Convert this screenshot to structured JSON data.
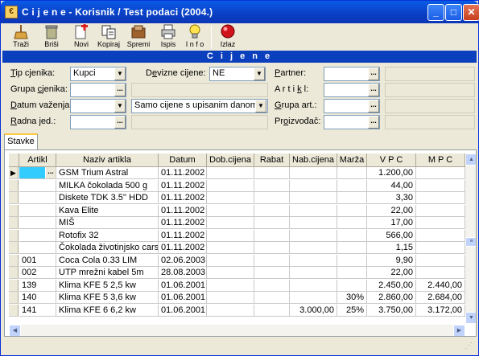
{
  "window": {
    "title": "C i j e n e - Korisnik / Test podaci (2004.)"
  },
  "toolbar": [
    {
      "label": "Traži",
      "icon": "search-broom-icon"
    },
    {
      "label": "Briši",
      "icon": "trash-icon"
    },
    {
      "label": "Novi",
      "icon": "new-document-icon"
    },
    {
      "label": "Kopiraj",
      "icon": "copy-icon"
    },
    {
      "label": "Spremi",
      "icon": "save-books-icon"
    },
    {
      "label": "Ispis",
      "icon": "printer-icon"
    },
    {
      "label": "I n f o",
      "icon": "info-lightbulb-icon"
    },
    {
      "label": "Izlaz",
      "icon": "exit-red-ball-icon"
    }
  ],
  "section_title": "C i j e n e",
  "filters": {
    "tip_cjenika": {
      "label_pre": "",
      "label_u": "T",
      "label_post": "ip cjenika:",
      "value": "Kupci"
    },
    "grupa_cjenika": {
      "label_pre": "Grupa ",
      "label_u": "c",
      "label_post": "jenika:",
      "value": ""
    },
    "datum_vazenja": {
      "label_pre": "",
      "label_u": "D",
      "label_post": "atum važenja:",
      "value": ""
    },
    "radna_jed": {
      "label_pre": "",
      "label_u": "R",
      "label_post": "adna jed.:",
      "value": ""
    },
    "devizne_cijene": {
      "label_pre": "D",
      "label_u": "e",
      "label_post": "vizne cijene:",
      "value": "NE"
    },
    "cijene_filter": {
      "value": "Samo cijene s upisanim danom"
    },
    "partner": {
      "label_pre": "",
      "label_u": "P",
      "label_post": "artner:",
      "value": ""
    },
    "artikl": {
      "label_pre": "A r t i ",
      "label_u": "k",
      "label_post": " l:",
      "value": ""
    },
    "grupa_art": {
      "label_pre": "",
      "label_u": "G",
      "label_post": "rupa art.:",
      "value": ""
    },
    "proizvodac": {
      "label_pre": "Pr",
      "label_u": "o",
      "label_post": "izvođač:",
      "value": ""
    }
  },
  "tab": {
    "label": "Stavke"
  },
  "grid": {
    "columns": [
      "Artikl",
      "Naziv artikla",
      "Datum",
      "Dob.cijena",
      "Rabat",
      "Nab.cijena",
      "Marža",
      "V P C",
      "M P C"
    ],
    "rows": [
      [
        "",
        "GSM Trium Astral",
        "01.11.2002",
        "",
        "",
        "",
        "",
        "1.200,00",
        ""
      ],
      [
        "",
        "MILKA čokolada 500 g",
        "01.11.2002",
        "",
        "",
        "",
        "",
        "44,00",
        ""
      ],
      [
        "",
        "Diskete TDK 3.5'' HDD",
        "01.11.2002",
        "",
        "",
        "",
        "",
        "3,30",
        ""
      ],
      [
        "",
        "Kava Elite",
        "01.11.2002",
        "",
        "",
        "",
        "",
        "22,00",
        ""
      ],
      [
        "",
        "MIŠ",
        "01.11.2002",
        "",
        "",
        "",
        "",
        "17,00",
        ""
      ],
      [
        "",
        "Rotofix 32",
        "01.11.2002",
        "",
        "",
        "",
        "",
        "566,00",
        ""
      ],
      [
        "",
        "Čokolada  životinjsko cars",
        "01.11.2002",
        "",
        "",
        "",
        "",
        "1,15",
        ""
      ],
      [
        "001",
        "Coca Cola 0.33 LIM",
        "02.06.2003",
        "",
        "",
        "",
        "",
        "9,90",
        ""
      ],
      [
        "002",
        "UTP mrežni kabel 5m",
        "28.08.2003",
        "",
        "",
        "",
        "",
        "22,00",
        ""
      ],
      [
        "139",
        "Klima KFE 5 2,5 kw",
        "01.06.2001",
        "",
        "",
        "",
        "",
        "2.450,00",
        "2.440,00"
      ],
      [
        "140",
        "Klima KFE 5 3,6 kw",
        "01.06.2001",
        "",
        "",
        "",
        "30%",
        "2.860,00",
        "2.684,00"
      ],
      [
        "141",
        "Klima KFE 6 6,2 kw",
        "01.06.2001",
        "",
        "",
        "3.000,00",
        "25%",
        "3.750,00",
        "3.172,00"
      ]
    ]
  }
}
